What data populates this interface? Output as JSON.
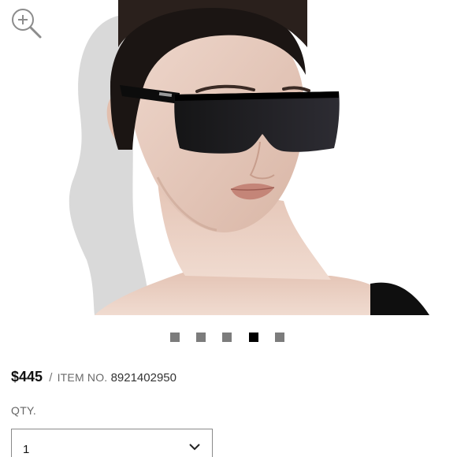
{
  "product": {
    "price": "$445",
    "separator": "/",
    "item_no_label": "ITEM NO.",
    "item_no": "8921402950"
  },
  "quantity": {
    "label": "QTY.",
    "selected_value": "1"
  },
  "gallery": {
    "image_count": 5,
    "active_index": 3,
    "zoom_icon": "zoom-in-icon",
    "chevron_icon": "chevron-down-icon"
  },
  "colors": {
    "dot_inactive": "#7c7c7c",
    "dot_active": "#000000",
    "text_primary": "#111111",
    "text_secondary": "#666666"
  }
}
